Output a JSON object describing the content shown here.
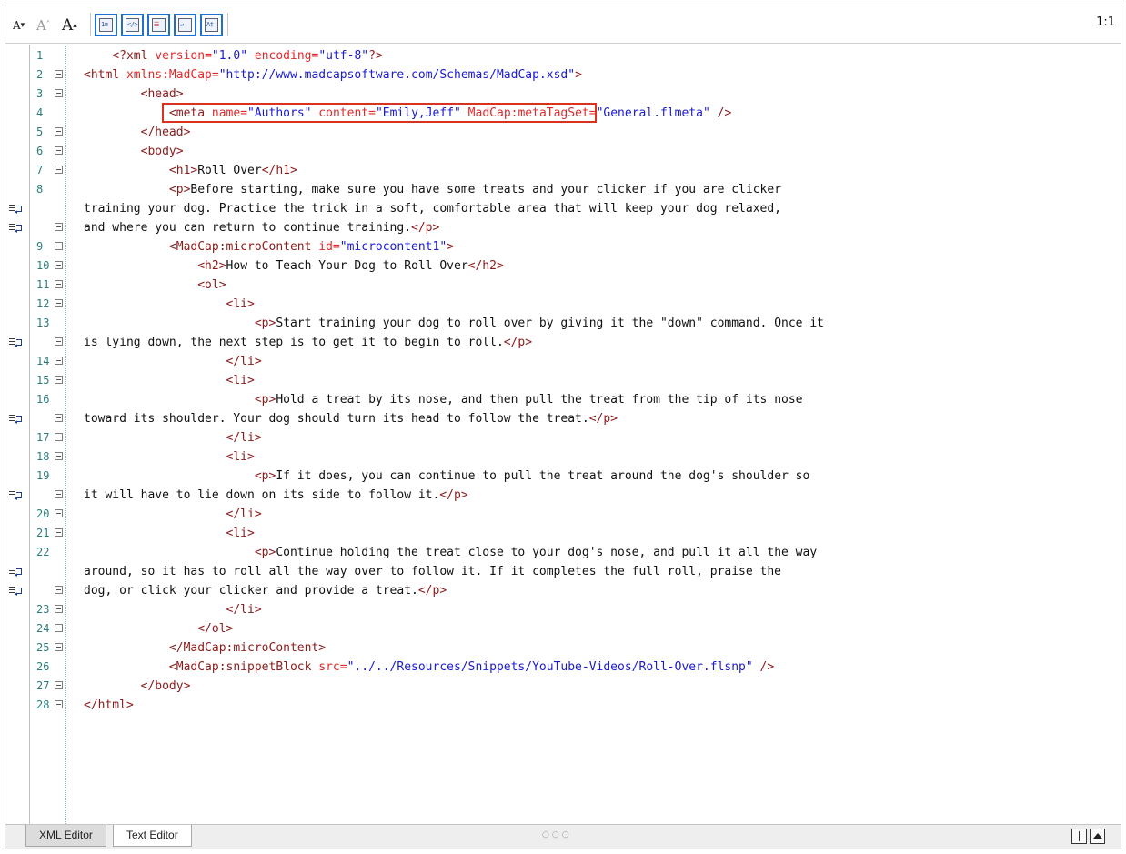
{
  "toolbar": {
    "decrease_font_label": "A",
    "reset_font_label": "A",
    "increase_font_label": "A",
    "icons": [
      "line-numbers-icon",
      "code-view-icon",
      "outline-icon",
      "word-wrap-icon",
      "font-settings-icon"
    ],
    "position": "1:1"
  },
  "colors": {
    "tag": "#8b1a1a",
    "attribute": "#e02a2a",
    "value": "#1a1ad0",
    "text": "#111111",
    "line_number": "#2a7e7e",
    "highlight_box": "#d9321f",
    "toolbar_selected_border": "#1f6fd1"
  },
  "code_lines": [
    {
      "n": "1",
      "fold": false,
      "segs": [
        {
          "c": "t",
          "t": "    <?"
        },
        {
          "c": "t",
          "t": "xml "
        },
        {
          "c": "a",
          "t": "version="
        },
        {
          "c": "v",
          "t": "\"1.0\""
        },
        {
          "c": "a",
          "t": " encoding="
        },
        {
          "c": "v",
          "t": "\"utf-8\""
        },
        {
          "c": "t",
          "t": "?>"
        }
      ]
    },
    {
      "n": "2",
      "fold": true,
      "segs": [
        {
          "c": "t",
          "t": "<html "
        },
        {
          "c": "a",
          "t": "xmlns:MadCap="
        },
        {
          "c": "v",
          "t": "\"http://www.madcapsoftware.com/Schemas/MadCap.xsd\""
        },
        {
          "c": "t",
          "t": ">"
        }
      ]
    },
    {
      "n": "3",
      "fold": true,
      "segs": [
        {
          "c": "t",
          "t": "        <head>"
        }
      ]
    },
    {
      "n": "4",
      "fold": false,
      "segs": [
        {
          "c": "t",
          "t": "            <meta "
        },
        {
          "c": "a",
          "t": "name="
        },
        {
          "c": "v",
          "t": "\"Authors\""
        },
        {
          "c": "a",
          "t": " content="
        },
        {
          "c": "v",
          "t": "\"Emily,Jeff\""
        },
        {
          "c": "a",
          "t": " MadCap:metaTagSet="
        },
        {
          "c": "v",
          "t": "\"General.flmeta\""
        },
        {
          "c": "t",
          "t": " />"
        }
      ]
    },
    {
      "n": "5",
      "fold": true,
      "segs": [
        {
          "c": "t",
          "t": "        </head>"
        }
      ]
    },
    {
      "n": "6",
      "fold": true,
      "segs": [
        {
          "c": "t",
          "t": "        <body>"
        }
      ]
    },
    {
      "n": "7",
      "fold": true,
      "segs": [
        {
          "c": "t",
          "t": "            <h1>"
        },
        {
          "c": "x",
          "t": "Roll Over"
        },
        {
          "c": "t",
          "t": "</h1>"
        }
      ]
    },
    {
      "n": "8",
      "fold": false,
      "segs": [
        {
          "c": "t",
          "t": "            <p>"
        },
        {
          "c": "x",
          "t": "Before starting, make sure you have some treats and your clicker if you are clicker"
        }
      ]
    },
    {
      "n": "",
      "fold": false,
      "wrap": true,
      "segs": [
        {
          "c": "x",
          "t": "training your dog. Practice the trick in a soft, comfortable area that will keep your dog relaxed,"
        }
      ]
    },
    {
      "n": "",
      "fold": true,
      "wrap": true,
      "segs": [
        {
          "c": "x",
          "t": "and where you can return to continue training."
        },
        {
          "c": "t",
          "t": "</p>"
        }
      ]
    },
    {
      "n": "9",
      "fold": true,
      "segs": [
        {
          "c": "t",
          "t": "            <MadCap:microContent "
        },
        {
          "c": "a",
          "t": "id="
        },
        {
          "c": "v",
          "t": "\"microcontent1\""
        },
        {
          "c": "t",
          "t": ">"
        }
      ]
    },
    {
      "n": "10",
      "fold": true,
      "segs": [
        {
          "c": "t",
          "t": "                <h2>"
        },
        {
          "c": "x",
          "t": "How to Teach Your Dog to Roll Over"
        },
        {
          "c": "t",
          "t": "</h2>"
        }
      ]
    },
    {
      "n": "11",
      "fold": true,
      "segs": [
        {
          "c": "t",
          "t": "                <ol>"
        }
      ]
    },
    {
      "n": "12",
      "fold": true,
      "segs": [
        {
          "c": "t",
          "t": "                    <li>"
        }
      ]
    },
    {
      "n": "13",
      "fold": false,
      "segs": [
        {
          "c": "t",
          "t": "                        <p>"
        },
        {
          "c": "x",
          "t": "Start training your dog to roll over by giving it the \"down\" command. Once it"
        }
      ]
    },
    {
      "n": "",
      "fold": true,
      "wrap": true,
      "segs": [
        {
          "c": "x",
          "t": "is lying down, the next step is to get it to begin to roll."
        },
        {
          "c": "t",
          "t": "</p>"
        }
      ]
    },
    {
      "n": "14",
      "fold": true,
      "segs": [
        {
          "c": "t",
          "t": "                    </li>"
        }
      ]
    },
    {
      "n": "15",
      "fold": true,
      "segs": [
        {
          "c": "t",
          "t": "                    <li>"
        }
      ]
    },
    {
      "n": "16",
      "fold": false,
      "segs": [
        {
          "c": "t",
          "t": "                        <p>"
        },
        {
          "c": "x",
          "t": "Hold a treat by its nose, and then pull the treat from the tip of its nose"
        }
      ]
    },
    {
      "n": "",
      "fold": true,
      "wrap": true,
      "segs": [
        {
          "c": "x",
          "t": "toward its shoulder. Your dog should turn its head to follow the treat."
        },
        {
          "c": "t",
          "t": "</p>"
        }
      ]
    },
    {
      "n": "17",
      "fold": true,
      "segs": [
        {
          "c": "t",
          "t": "                    </li>"
        }
      ]
    },
    {
      "n": "18",
      "fold": true,
      "segs": [
        {
          "c": "t",
          "t": "                    <li>"
        }
      ]
    },
    {
      "n": "19",
      "fold": false,
      "segs": [
        {
          "c": "t",
          "t": "                        <p>"
        },
        {
          "c": "x",
          "t": "If it does, you can continue to pull the treat around the dog's shoulder so"
        }
      ]
    },
    {
      "n": "",
      "fold": true,
      "wrap": true,
      "segs": [
        {
          "c": "x",
          "t": "it will have to lie down on its side to follow it."
        },
        {
          "c": "t",
          "t": "</p>"
        }
      ]
    },
    {
      "n": "20",
      "fold": true,
      "segs": [
        {
          "c": "t",
          "t": "                    </li>"
        }
      ]
    },
    {
      "n": "21",
      "fold": true,
      "segs": [
        {
          "c": "t",
          "t": "                    <li>"
        }
      ]
    },
    {
      "n": "22",
      "fold": false,
      "segs": [
        {
          "c": "t",
          "t": "                        <p>"
        },
        {
          "c": "x",
          "t": "Continue holding the treat close to your dog's nose, and pull it all the way"
        }
      ]
    },
    {
      "n": "",
      "fold": false,
      "wrap": true,
      "segs": [
        {
          "c": "x",
          "t": "around, so it has to roll all the way over to follow it. If it completes the full roll, praise the"
        }
      ]
    },
    {
      "n": "",
      "fold": true,
      "wrap": true,
      "segs": [
        {
          "c": "x",
          "t": "dog, or click your clicker and provide a treat."
        },
        {
          "c": "t",
          "t": "</p>"
        }
      ]
    },
    {
      "n": "23",
      "fold": true,
      "segs": [
        {
          "c": "t",
          "t": "                    </li>"
        }
      ]
    },
    {
      "n": "24",
      "fold": true,
      "segs": [
        {
          "c": "t",
          "t": "                </ol>"
        }
      ]
    },
    {
      "n": "25",
      "fold": true,
      "segs": [
        {
          "c": "t",
          "t": "            </MadCap:microContent>"
        }
      ]
    },
    {
      "n": "26",
      "fold": false,
      "segs": [
        {
          "c": "t",
          "t": "            <MadCap:snippetBlock "
        },
        {
          "c": "a",
          "t": "src="
        },
        {
          "c": "v",
          "t": "\"../../Resources/Snippets/YouTube-Videos/Roll-Over.flsnp\""
        },
        {
          "c": "t",
          "t": " />"
        }
      ]
    },
    {
      "n": "27",
      "fold": true,
      "segs": [
        {
          "c": "t",
          "t": "        </body>"
        }
      ]
    },
    {
      "n": "28",
      "fold": true,
      "segs": [
        {
          "c": "t",
          "t": "</html>"
        }
      ]
    }
  ],
  "tabs": [
    {
      "label": "XML Editor",
      "active": false
    },
    {
      "label": "Text Editor",
      "active": true
    }
  ]
}
